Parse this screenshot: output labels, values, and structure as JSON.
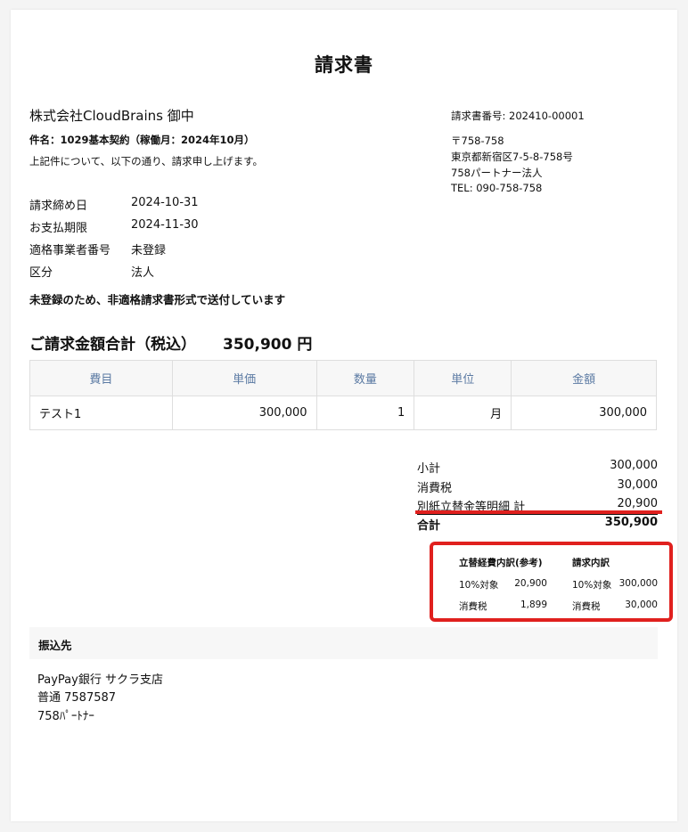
{
  "document": {
    "title": "請求書",
    "recipient": "株式会社CloudBrains 御中",
    "subject": "件名：1029基本契約（稼働月：2024年10月）",
    "intro": "上記件について、以下の通り、請求申し上げます。"
  },
  "sender": {
    "invoice_number": "請求書番号: 202410-00001",
    "postal": "〒758-758",
    "address": "東京都新宿区7-5-8-758号",
    "name": "758パートナー法人",
    "tel": "TEL: 090-758-758"
  },
  "info": [
    {
      "label": "請求締め日",
      "value": "2024-10-31"
    },
    {
      "label": "お支払期限",
      "value": "2024-11-30"
    },
    {
      "label": "適格事業者番号",
      "value": "未登録"
    },
    {
      "label": "区分",
      "value": "法人"
    }
  ],
  "notice": "未登録のため、非適格請求書形式で送付しています",
  "total": {
    "label": "ご請求金額合計（税込）",
    "value": "350,900 円"
  },
  "table": {
    "headers": [
      "費目",
      "単価",
      "数量",
      "単位",
      "金額"
    ],
    "rows": [
      [
        "テスト1",
        "300,000",
        "1",
        "月",
        "300,000"
      ]
    ]
  },
  "summary": [
    {
      "label": "小計",
      "value": "300,000"
    },
    {
      "label": "消費税",
      "value": "30,000"
    },
    {
      "label": "別紙立替金等明細 計",
      "value": "20,900"
    },
    {
      "label": "合計",
      "value": "350,900"
    }
  ],
  "breakdown": {
    "left_title": "立替経費内訳(参考)",
    "right_title": "請求内訳",
    "rows": [
      {
        "l_label": "10%対象",
        "l_value": "20,900",
        "r_label": "10%対象",
        "r_value": "300,000"
      },
      {
        "l_label": "消費税",
        "l_value": "1,899",
        "r_label": "消費税",
        "r_value": "30,000"
      }
    ]
  },
  "bank": {
    "header": "振込先",
    "line1": "PayPay銀行 サクラ支店",
    "line2": "普通 7587587",
    "line3": "758ﾊﾟｰﾄﾅｰ"
  },
  "colors": {
    "highlight": "#e0201e",
    "table_header_text": "#5b7aa3"
  }
}
